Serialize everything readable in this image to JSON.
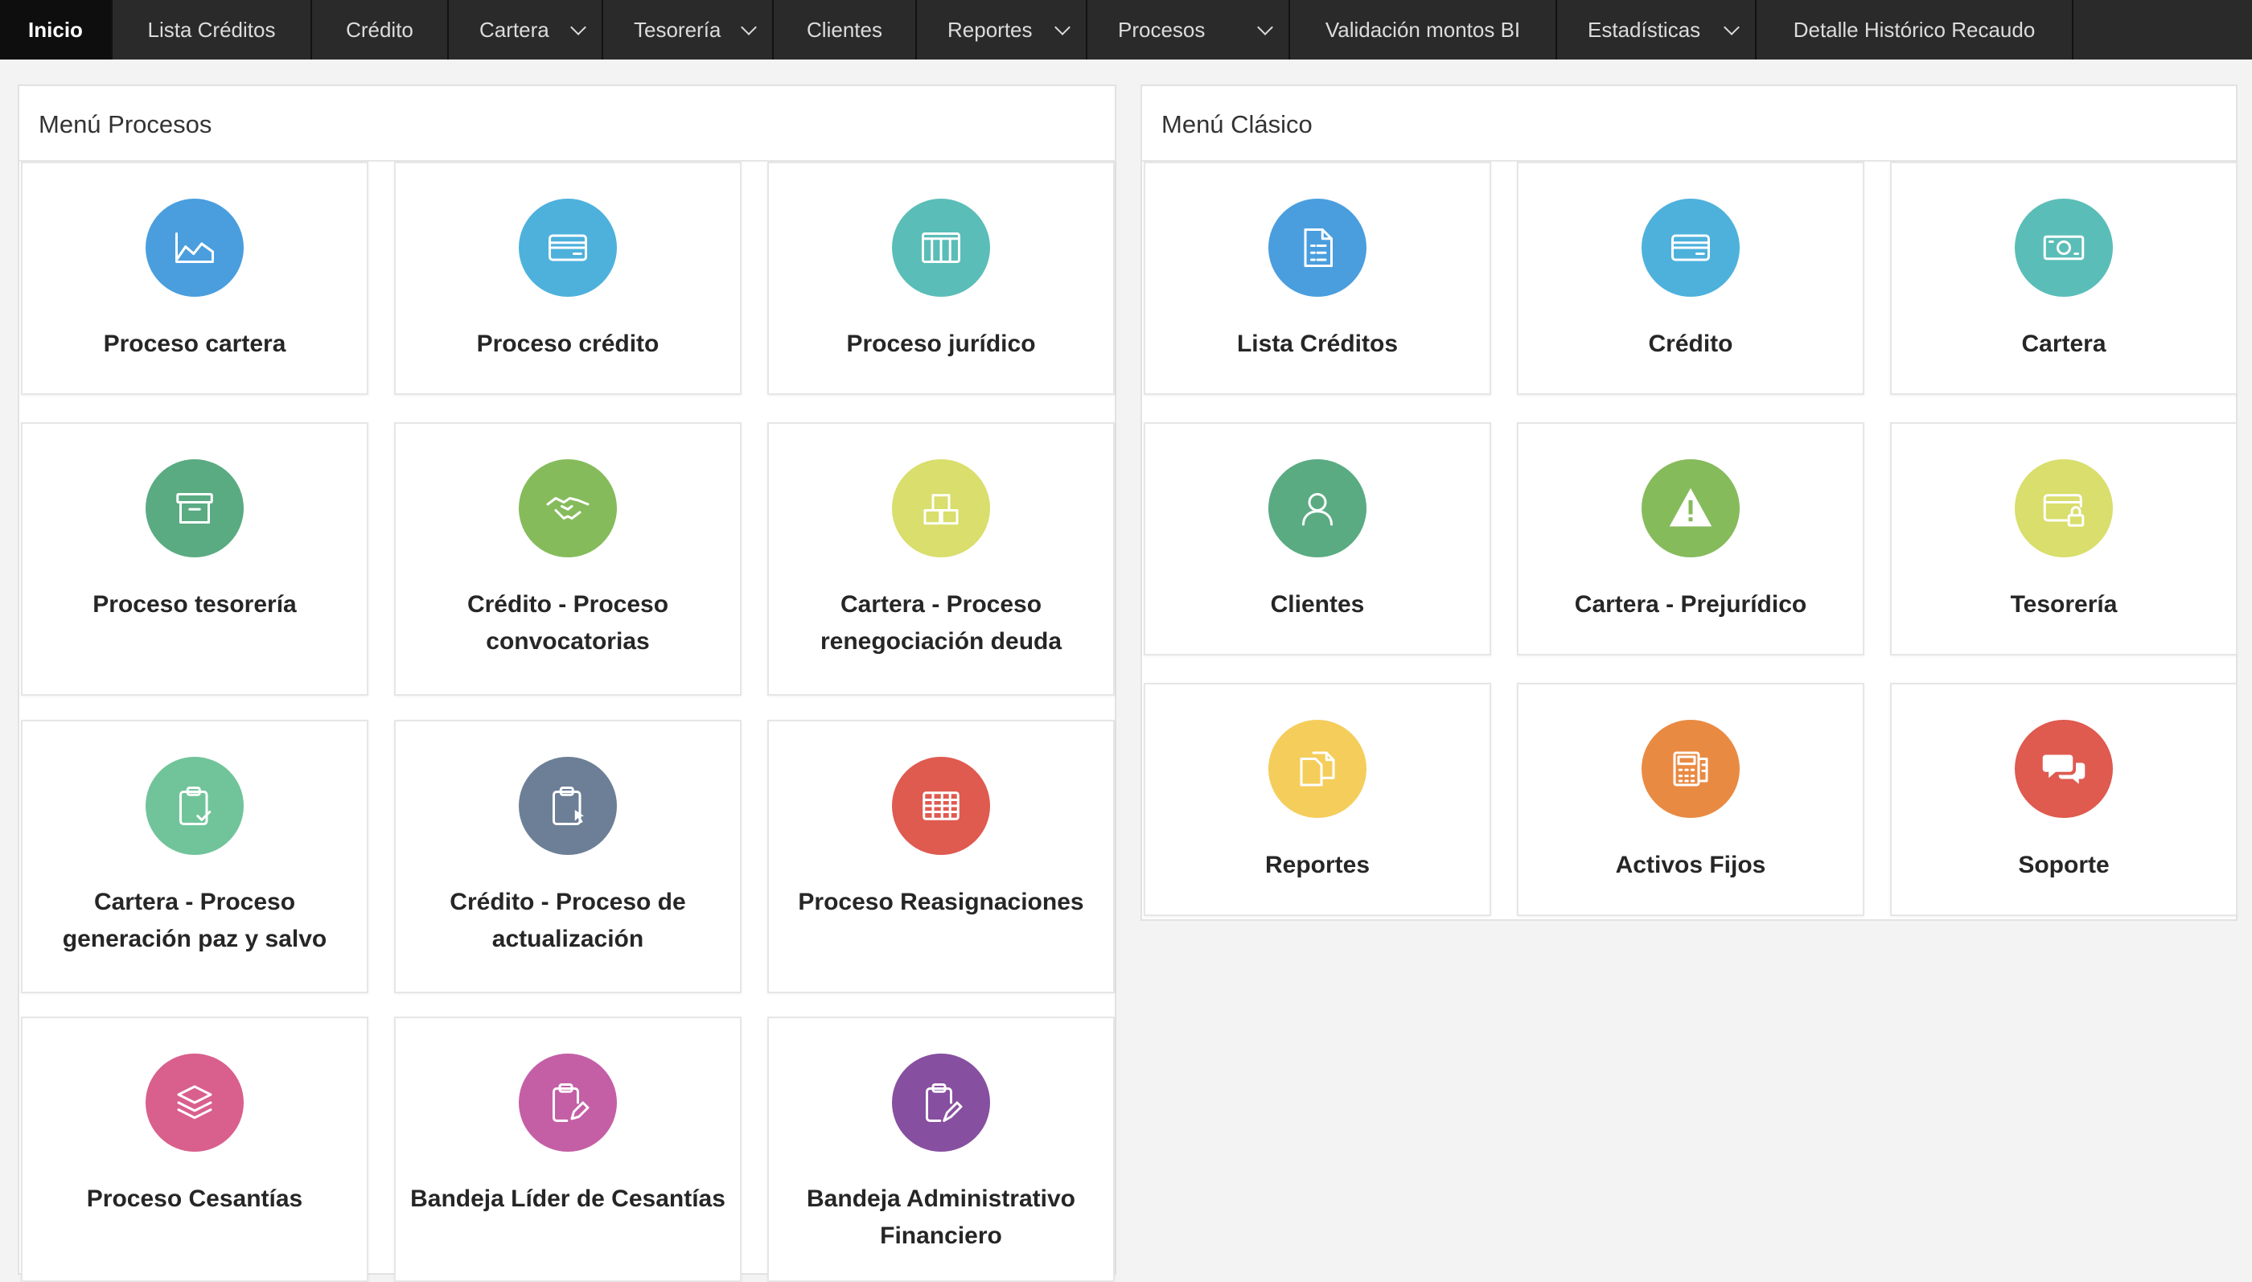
{
  "nav": {
    "items": [
      {
        "label": "Inicio",
        "active": true,
        "dropdown": false
      },
      {
        "label": "Lista Créditos",
        "active": false,
        "dropdown": false
      },
      {
        "label": "Crédito",
        "active": false,
        "dropdown": false
      },
      {
        "label": "Cartera",
        "active": false,
        "dropdown": true
      },
      {
        "label": "Tesorería",
        "active": false,
        "dropdown": true
      },
      {
        "label": "Clientes",
        "active": false,
        "dropdown": false
      },
      {
        "label": "Reportes",
        "active": false,
        "dropdown": true
      },
      {
        "label": "Procesos",
        "active": false,
        "dropdown": true
      },
      {
        "label": "Validación montos BI",
        "active": false,
        "dropdown": false
      },
      {
        "label": "Estadísticas",
        "active": false,
        "dropdown": true
      },
      {
        "label": "Detalle Histórico Recaudo",
        "active": false,
        "dropdown": false
      }
    ]
  },
  "procesos": {
    "title": "Menú Procesos",
    "tiles": [
      {
        "label": "Proceso cartera",
        "icon": "chart-area-icon",
        "color": "#4a9ede"
      },
      {
        "label": "Proceso crédito",
        "icon": "credit-card-icon",
        "color": "#4db1dc"
      },
      {
        "label": "Proceso jurídico",
        "icon": "columns-icon",
        "color": "#5bbdb8"
      },
      {
        "label": "Proceso tesorería",
        "icon": "archive-box-icon",
        "color": "#5aab82"
      },
      {
        "label": "Crédito - Proceso convocatorias",
        "icon": "handshake-icon",
        "color": "#86bb5c"
      },
      {
        "label": "Cartera - Proceso renegociación deuda",
        "icon": "boxes-icon",
        "color": "#d9de6c"
      },
      {
        "label": "Cartera - Proceso generación paz y salvo",
        "icon": "clipboard-check-icon",
        "color": "#71c49a"
      },
      {
        "label": "Crédito - Proceso de actualización",
        "icon": "clipboard-cursor-icon",
        "color": "#6c7f96"
      },
      {
        "label": "Proceso Reasignaciones",
        "icon": "table-grid-icon",
        "color": "#df5a4f"
      },
      {
        "label": "Proceso Cesantías",
        "icon": "layers-icon",
        "color": "#d95f8c"
      },
      {
        "label": "Bandeja Líder de Cesantías",
        "icon": "clipboard-edit-icon",
        "color": "#c45fa6"
      },
      {
        "label": "Bandeja Administrativo Financiero",
        "icon": "clipboard-pen-icon",
        "color": "#874fa0"
      }
    ]
  },
  "clasico": {
    "title": "Menú Clásico",
    "tiles": [
      {
        "label": "Lista Créditos",
        "icon": "document-list-icon",
        "color": "#4a9ede"
      },
      {
        "label": "Crédito",
        "icon": "credit-card-icon",
        "color": "#4db1dc"
      },
      {
        "label": "Cartera",
        "icon": "cash-icon",
        "color": "#5bbdb8"
      },
      {
        "label": "Clientes",
        "icon": "user-icon",
        "color": "#5aab82"
      },
      {
        "label": "Cartera - Prejurídico",
        "icon": "warning-icon",
        "color": "#86bb5c"
      },
      {
        "label": "Tesorería",
        "icon": "card-lock-icon",
        "color": "#d9de6c"
      },
      {
        "label": "Reportes",
        "icon": "files-icon",
        "color": "#f4cd5b"
      },
      {
        "label": "Activos Fijos",
        "icon": "calculator-icon",
        "color": "#e98a43"
      },
      {
        "label": "Soporte",
        "icon": "chat-bubbles-icon",
        "color": "#df5a4f"
      }
    ]
  }
}
